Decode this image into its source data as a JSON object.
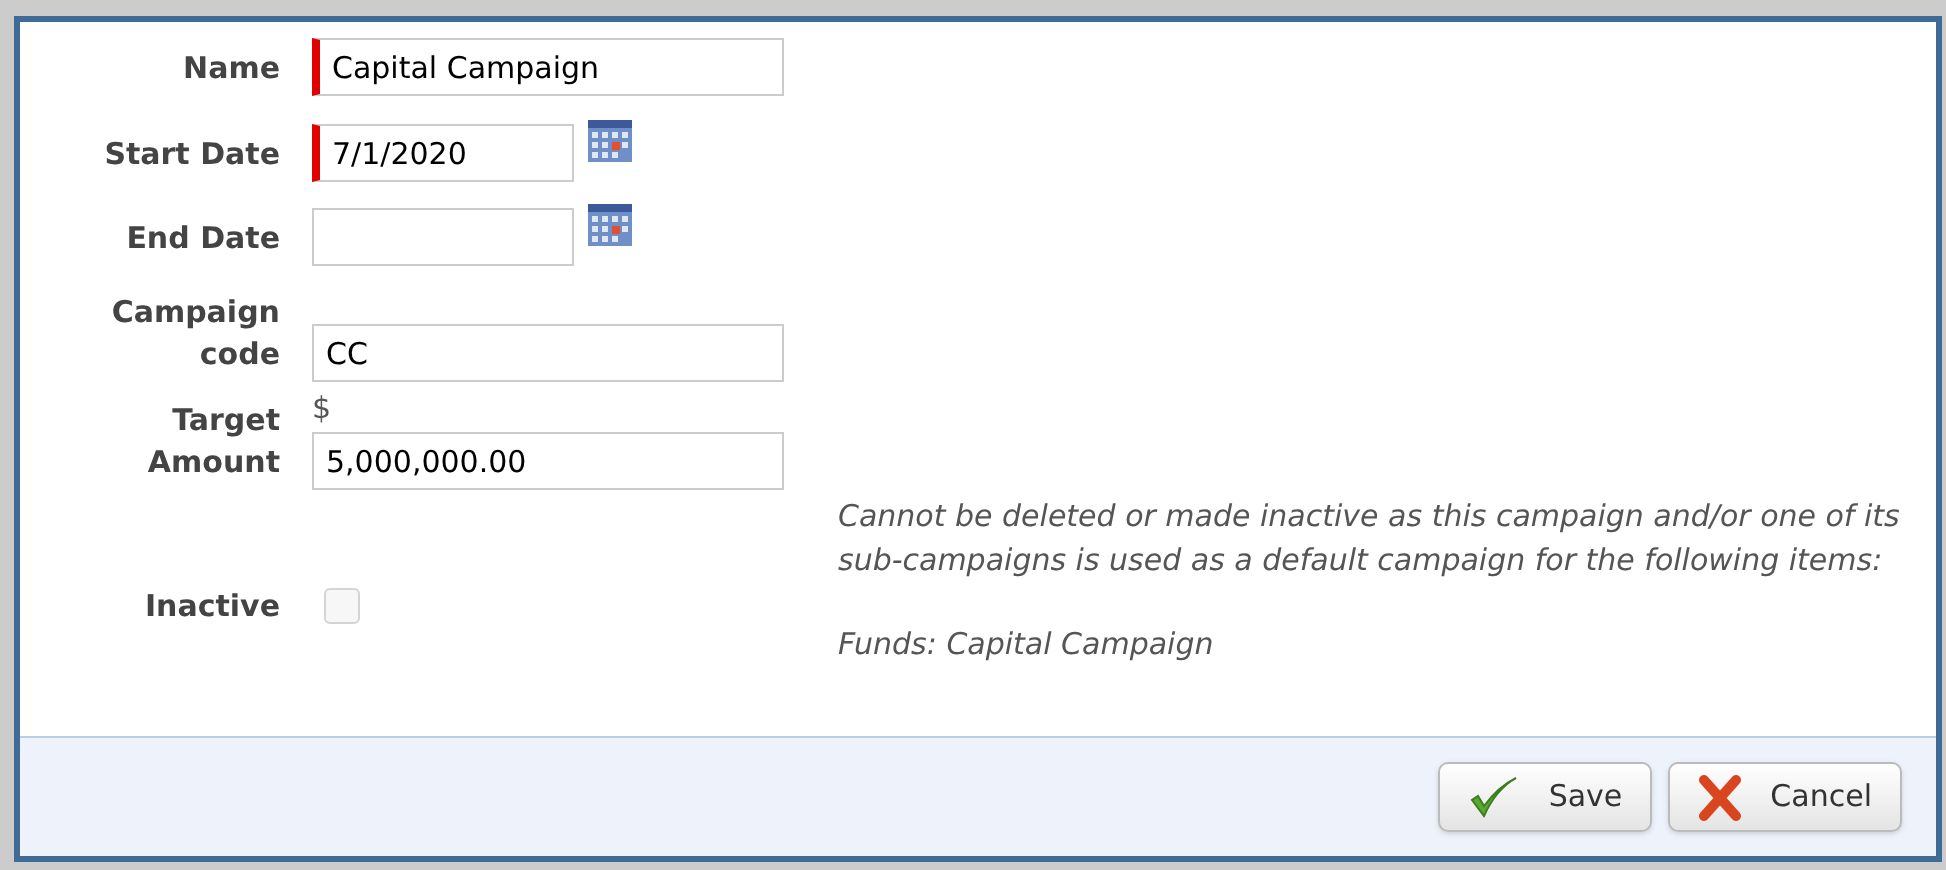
{
  "fields": [
    {
      "kind": "text",
      "label": "Name",
      "value": "Capital Campaign",
      "required": true
    },
    {
      "kind": "date",
      "label": "Start Date",
      "value": "7/1/2020",
      "required": true
    },
    {
      "kind": "date",
      "label": "End Date",
      "required": false
    },
    {
      "kind": "text",
      "label": "Campaign code",
      "value": "CC",
      "required": false
    },
    {
      "kind": "text",
      "label": "Target Amount",
      "prefix": "$",
      "value": "5,000,000.00",
      "required": false
    }
  ],
  "inactive": {
    "label": "Inactive",
    "checked": false,
    "disabled": true
  },
  "message": [
    "Cannot be deleted or made inactive as this campaign and/or one of its sub-campaigns is used as a default campaign for the following items:",
    "Funds: Capital Campaign"
  ],
  "buttons": [
    {
      "kind": "save",
      "label": "Save"
    },
    {
      "kind": "cancel",
      "label": "Cancel"
    }
  ]
}
